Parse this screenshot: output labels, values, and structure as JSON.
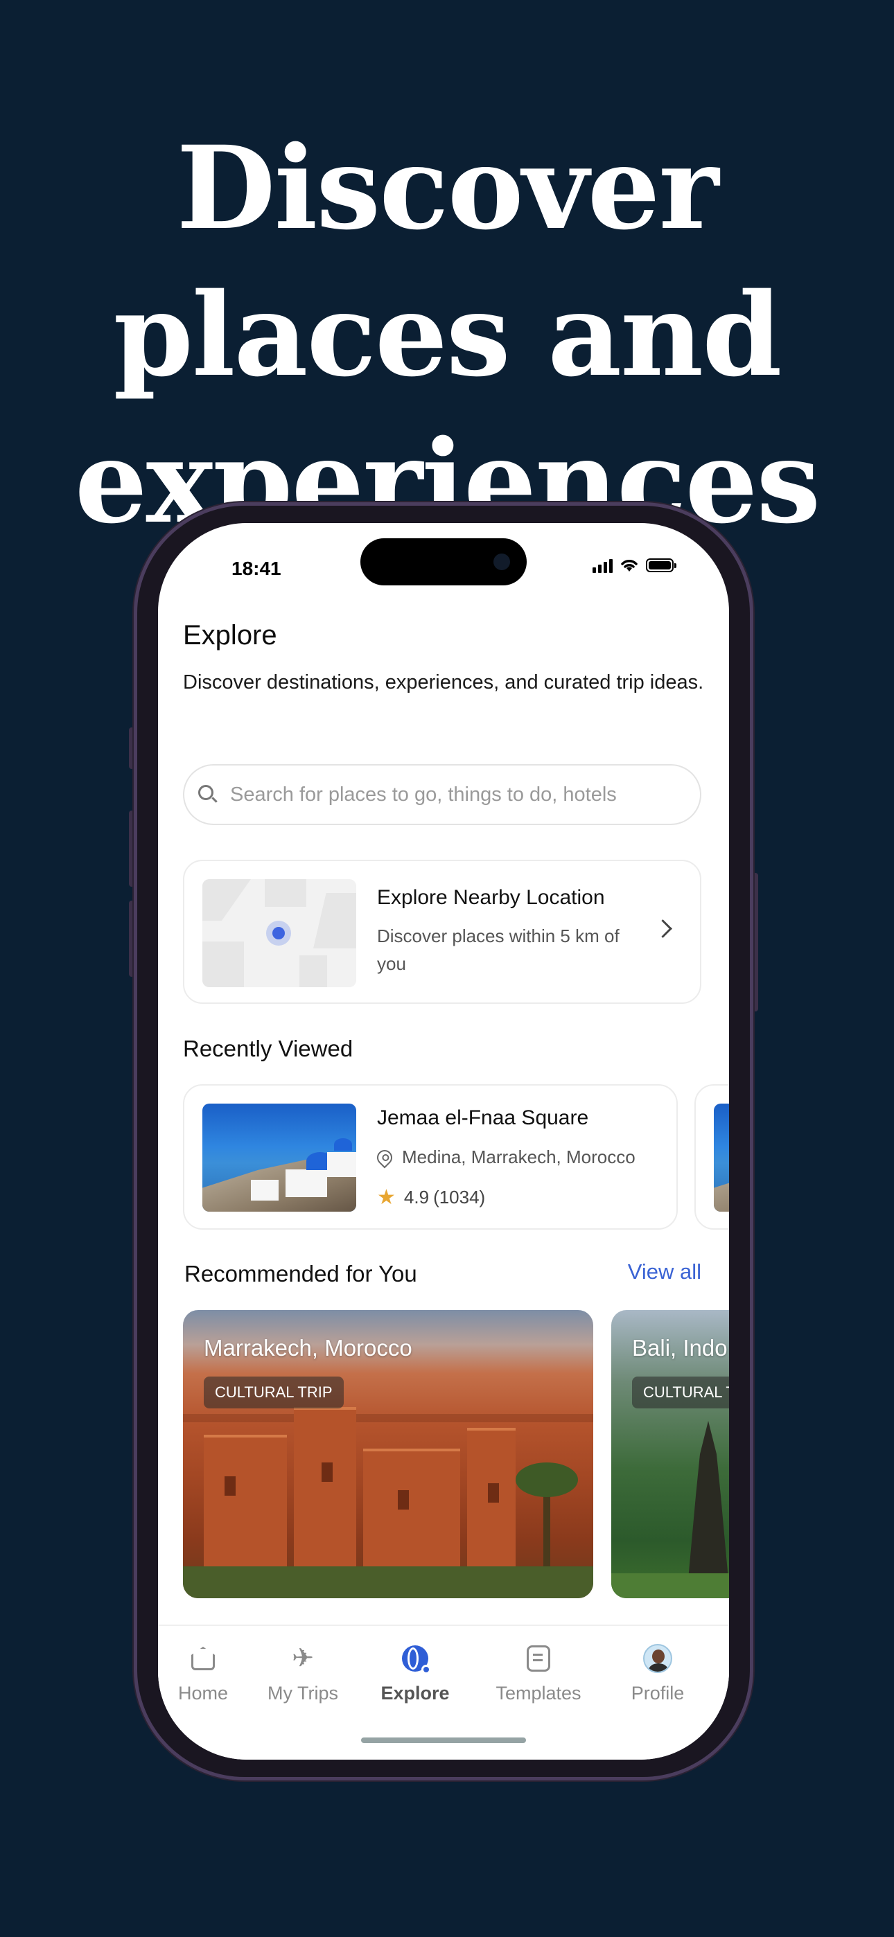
{
  "headline": [
    "Discover",
    "places and",
    "experiences"
  ],
  "status_bar": {
    "time": "18:41"
  },
  "page": {
    "title": "Explore",
    "subtitle": "Discover destinations, experiences, and curated trip ideas."
  },
  "search": {
    "placeholder": "Search for places to go, things to do, hotels"
  },
  "nearby": {
    "title": "Explore Nearby Location",
    "description": "Discover places within 5 km of you"
  },
  "recently_viewed": {
    "heading": "Recently Viewed",
    "items": [
      {
        "title": "Jemaa el-Fnaa Square",
        "location": "Medina, Marrakech, Morocco",
        "rating": "4.9",
        "reviews": "(1034)"
      }
    ]
  },
  "recommended": {
    "heading": "Recommended for You",
    "view_all": "View all",
    "items": [
      {
        "name": "Marrakech, Morocco",
        "tag": "CULTURAL TRIP"
      },
      {
        "name": "Bali, Indo",
        "tag": "CULTURAL T"
      }
    ]
  },
  "tab_bar": {
    "tabs": [
      {
        "label": "Home",
        "icon": "home-icon"
      },
      {
        "label": "My Trips",
        "icon": "plane-icon"
      },
      {
        "label": "Explore",
        "icon": "globe-icon",
        "active": true
      },
      {
        "label": "Templates",
        "icon": "document-icon"
      },
      {
        "label": "Profile",
        "icon": "avatar-icon"
      }
    ]
  },
  "colors": {
    "background": "#0b1f33",
    "accent": "#3a63d4",
    "star": "#e8a631"
  }
}
